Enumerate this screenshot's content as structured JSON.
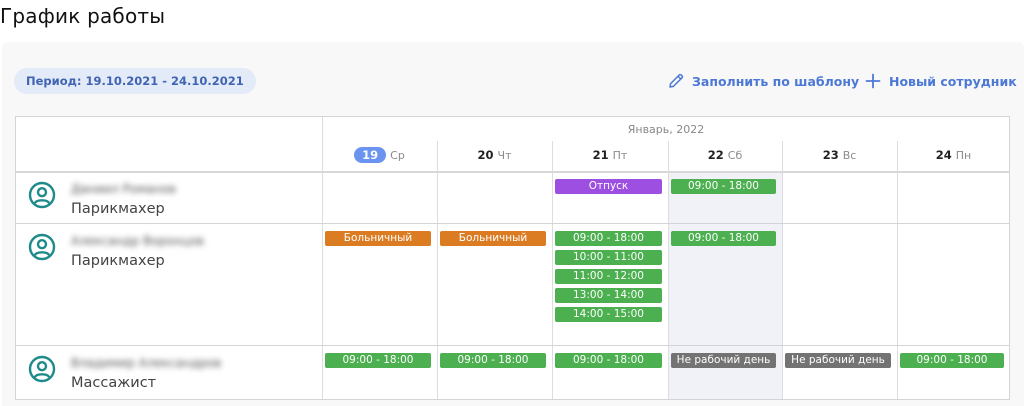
{
  "page": {
    "title": "График работы"
  },
  "toolbar": {
    "period": "Период: 19.10.2021 - 24.10.2021",
    "fill_template": "Заполнить по шаблону",
    "new_employee": "Новый сотрудник",
    "icons": {
      "fill_template": "pencil-icon",
      "new_employee": "plus-icon"
    }
  },
  "calendar": {
    "month": "Январь, 2022",
    "days": [
      {
        "num": "19",
        "weekday": "Ср",
        "today": true
      },
      {
        "num": "20",
        "weekday": "Чт"
      },
      {
        "num": "21",
        "weekday": "Пт"
      },
      {
        "num": "22",
        "weekday": "Сб"
      },
      {
        "num": "23",
        "weekday": "Вс"
      },
      {
        "num": "24",
        "weekday": "Пн"
      }
    ]
  },
  "employees": [
    {
      "name": "Даниил Романов",
      "role": "Парикмахер",
      "shifts": [
        {
          "day": 2,
          "label": "Отпуск",
          "kind": "vacation"
        },
        {
          "day": 3,
          "label": "09:00 - 18:00",
          "kind": "work"
        }
      ]
    },
    {
      "name": "Александр Воронцов",
      "role": "Парикмахер",
      "shifts": [
        {
          "day": 0,
          "label": "Больничный",
          "kind": "sick"
        },
        {
          "day": 1,
          "label": "Больничный",
          "kind": "sick"
        },
        {
          "day": 2,
          "label": "09:00 - 18:00",
          "kind": "work"
        },
        {
          "day": 2,
          "label": "10:00 - 11:00",
          "kind": "work"
        },
        {
          "day": 2,
          "label": "11:00 - 12:00",
          "kind": "work"
        },
        {
          "day": 2,
          "label": "13:00 - 14:00",
          "kind": "work"
        },
        {
          "day": 2,
          "label": "14:00 - 15:00",
          "kind": "work"
        },
        {
          "day": 3,
          "label": "09:00 - 18:00",
          "kind": "work"
        }
      ]
    },
    {
      "name": "Владимир Александров",
      "role": "Массажист",
      "shifts": [
        {
          "day": 0,
          "label": "09:00 - 18:00",
          "kind": "work"
        },
        {
          "day": 1,
          "label": "09:00 - 18:00",
          "kind": "work"
        },
        {
          "day": 2,
          "label": "09:00 - 18:00",
          "kind": "work"
        },
        {
          "day": 3,
          "label": "Не рабочий день",
          "kind": "off"
        },
        {
          "day": 4,
          "label": "Не рабочий день",
          "kind": "off"
        },
        {
          "day": 5,
          "label": "09:00 - 18:00",
          "kind": "work"
        }
      ]
    }
  ],
  "colors": {
    "work": "#4caf50",
    "vacation": "#9c4fe0",
    "sick": "#db7b22",
    "off": "#737373",
    "accent": "#4d79d6",
    "avatar": "#1f8a8a"
  }
}
